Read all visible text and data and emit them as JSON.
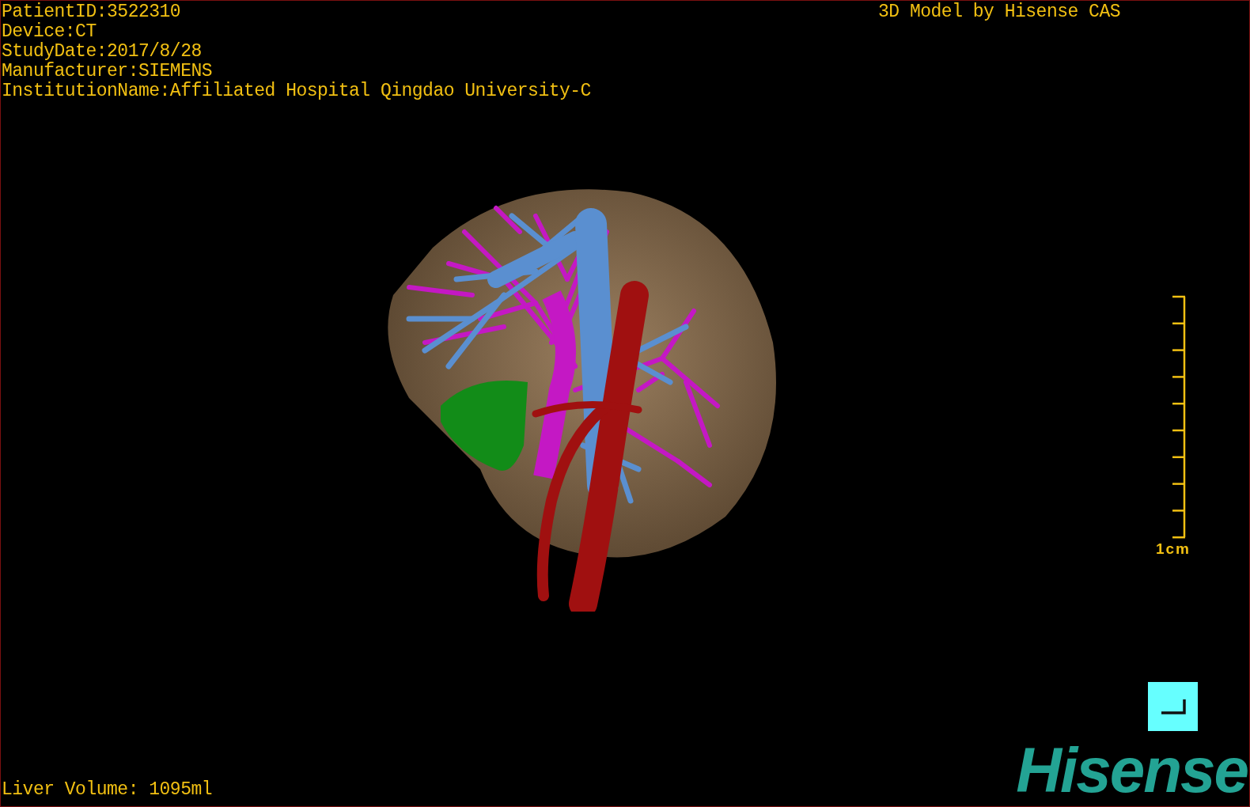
{
  "info_lines": [
    "PatientID:3522310",
    "Device:CT",
    "StudyDate:2017/8/28",
    "Manufacturer:SIEMENS",
    "InstitutionName:Affiliated Hospital Qingdao University-C"
  ],
  "title": "3D Model by Hisense CAS",
  "scale_bar": {
    "label": "1cm"
  },
  "volume": "Liver Volume: 1095ml",
  "logo": "Hisense"
}
